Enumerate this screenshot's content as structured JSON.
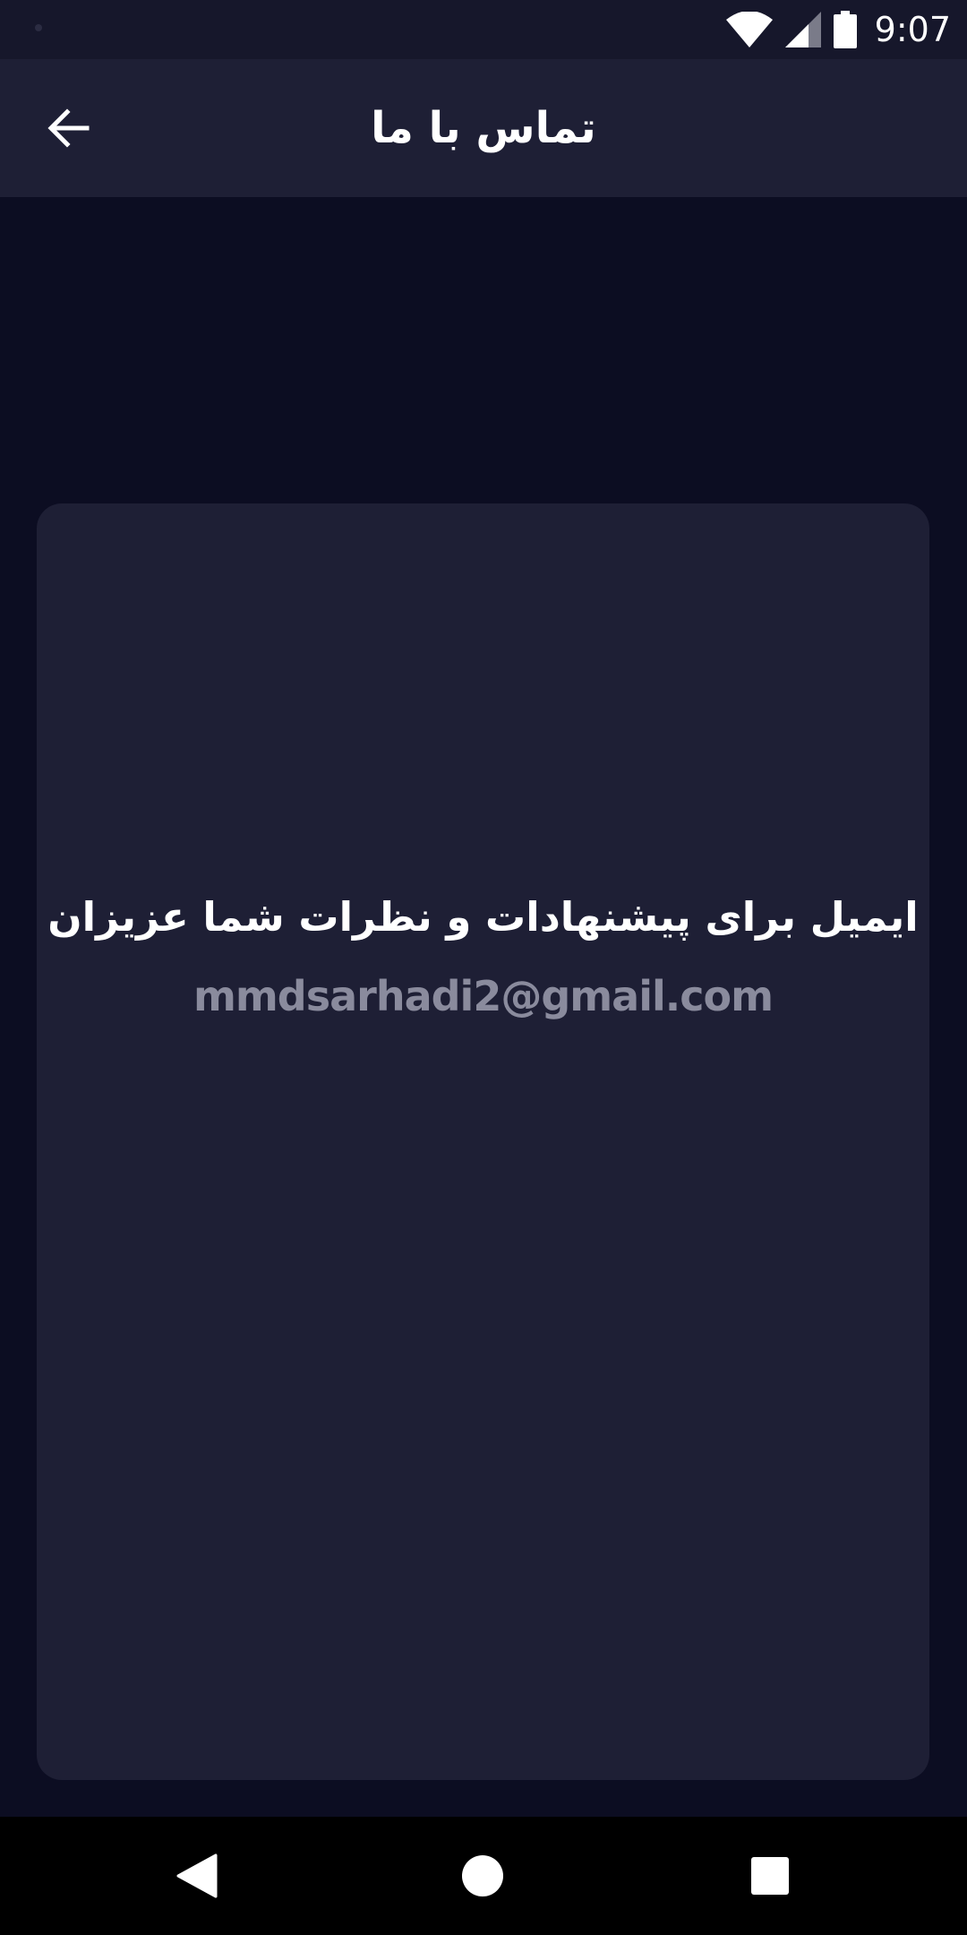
{
  "status_bar": {
    "time": "9:07",
    "icons": [
      "notification-dot-icon",
      "wifi-icon",
      "cell-signal-icon",
      "battery-icon"
    ]
  },
  "app_bar": {
    "title": "تماس با ما",
    "back_icon": "arrow-left-icon"
  },
  "card": {
    "heading": "ایمیل برای پیشنهادات و نظرات شما عزیزان",
    "email": "mmdsarhadi2@gmail.com"
  },
  "nav_bar": {
    "icons": [
      "nav-back-icon",
      "nav-home-icon",
      "nav-recents-icon"
    ]
  },
  "colors": {
    "background": "#0c0d22",
    "surface": "#1e1f35",
    "status_bar": "#16172b",
    "text_primary": "#ffffff",
    "text_secondary": "#8a8b9d"
  }
}
